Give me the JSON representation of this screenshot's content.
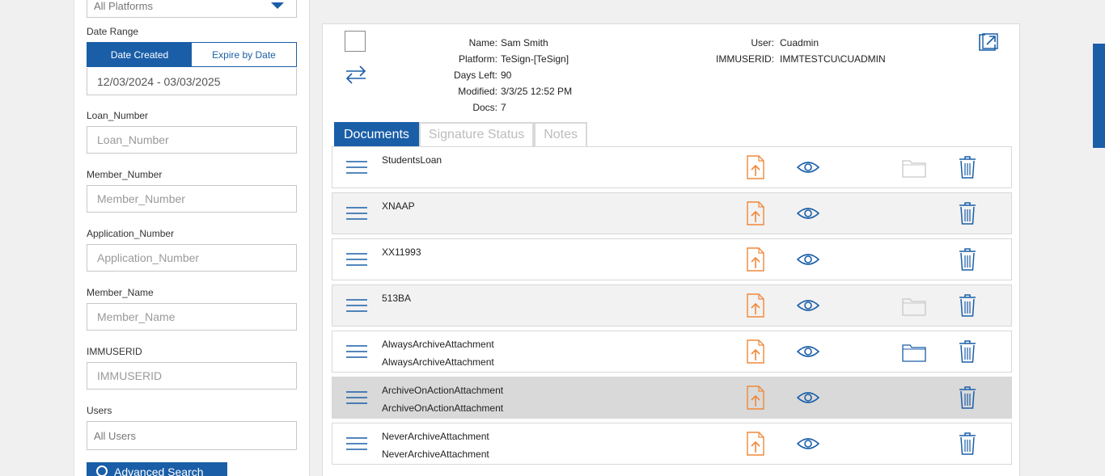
{
  "filters": {
    "platform_select": "All Platforms",
    "date_range_label": "Date Range",
    "date_tabs": [
      "Date Created",
      "Expire by Date"
    ],
    "date_value": "12/03/2024 - 03/03/2025",
    "fields": [
      {
        "label": "Loan_Number",
        "placeholder": "Loan_Number"
      },
      {
        "label": "Member_Number",
        "placeholder": "Member_Number"
      },
      {
        "label": "Application_Number",
        "placeholder": "Application_Number"
      },
      {
        "label": "Member_Name",
        "placeholder": "Member_Name"
      },
      {
        "label": "IMMUSERID",
        "placeholder": "IMMUSERID"
      }
    ],
    "users_label": "Users",
    "users_value": "All Users",
    "advanced_search_label": "Advanced Search"
  },
  "package": {
    "left_meta": [
      {
        "key": "Name:",
        "value": "Sam Smith"
      },
      {
        "key": "Platform:",
        "value": "TeSign-[TeSign]"
      },
      {
        "key": "Days Left:",
        "value": "90"
      },
      {
        "key": "Modified:",
        "value": "3/3/25 12:52 PM"
      },
      {
        "key": "Docs:",
        "value": "7"
      }
    ],
    "right_meta": [
      {
        "key": "User:",
        "value": "Cuadmin"
      },
      {
        "key": "IMMUSERID:",
        "value": "IMMTESTCU\\CUADMIN"
      }
    ]
  },
  "tabs": [
    "Documents",
    "Signature Status",
    "Notes"
  ],
  "documents": [
    {
      "line1": "StudentsLoan",
      "line2": "",
      "folder": "light"
    },
    {
      "line1": "XNAAP",
      "line2": "",
      "folder": "none"
    },
    {
      "line1": "XX11993",
      "line2": "",
      "folder": "none"
    },
    {
      "line1": "513BA",
      "line2": "",
      "folder": "light"
    },
    {
      "line1": "AlwaysArchiveAttachment",
      "line2": "AlwaysArchiveAttachment",
      "folder": "blue"
    },
    {
      "line1": "ArchiveOnActionAttachment",
      "line2": "ArchiveOnActionAttachment",
      "folder": "none"
    },
    {
      "line1": "NeverArchiveAttachment",
      "line2": "NeverArchiveAttachment",
      "folder": "none"
    }
  ],
  "colors": {
    "accent": "#1a5ea8",
    "upload": "#f0883a"
  }
}
